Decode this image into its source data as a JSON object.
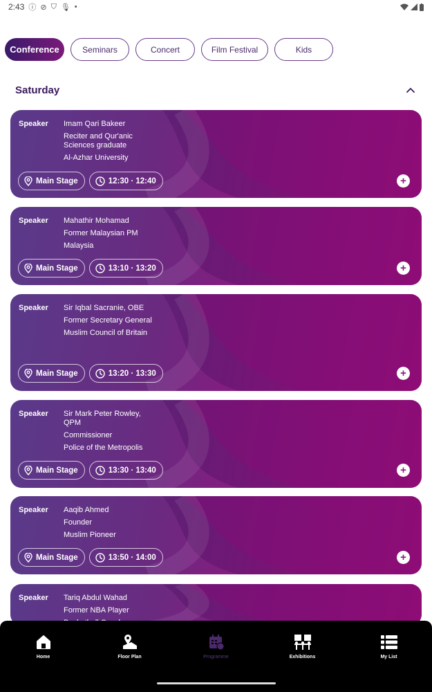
{
  "status_bar": {
    "time": "2:43"
  },
  "filters": [
    {
      "label": "Conference",
      "active": true
    },
    {
      "label": "Seminars",
      "active": false
    },
    {
      "label": "Concert",
      "active": false
    },
    {
      "label": "Film Festival",
      "active": false
    },
    {
      "label": "Kids",
      "active": false
    }
  ],
  "day": {
    "title": "Saturday"
  },
  "cards": [
    {
      "label": "Speaker",
      "lines": [
        "Imam Qari Bakeer",
        "Reciter and Qur'anic Sciences graduate",
        "Al-Azhar University"
      ],
      "location": "Main Stage",
      "time": "12:30 · 12:40"
    },
    {
      "label": "Speaker",
      "lines": [
        "Mahathir Mohamad",
        "Former Malaysian PM",
        "Malaysia"
      ],
      "location": "Main Stage",
      "time": "13:10 · 13:20"
    },
    {
      "label": "Speaker",
      "lines": [
        "Sir Iqbal Sacranie, OBE",
        "Former Secretary General",
        "Muslim Council of Britain"
      ],
      "location": "Main Stage",
      "time": "13:20 · 13:30"
    },
    {
      "label": "Speaker",
      "lines": [
        "Sir Mark Peter Rowley, QPM",
        "Commissioner",
        "Police of the Metropolis"
      ],
      "location": "Main Stage",
      "time": "13:30 · 13:40"
    },
    {
      "label": "Speaker",
      "lines": [
        "Aaqib Ahmed",
        "Founder",
        "Muslim Pioneer"
      ],
      "location": "Main Stage",
      "time": "13:50 · 14:00"
    },
    {
      "label": "Speaker",
      "lines": [
        "Tariq Abdul Wahad",
        "Former NBA Player",
        "Basketball Coach"
      ],
      "location": "",
      "time": ""
    }
  ],
  "nav": [
    {
      "label": "Home",
      "icon": "home-icon"
    },
    {
      "label": "Floor Plan",
      "icon": "map-icon"
    },
    {
      "label": "Programme",
      "icon": "calendar-icon"
    },
    {
      "label": "Exhibitions",
      "icon": "exhibition-icon"
    },
    {
      "label": "My List",
      "icon": "list-icon"
    }
  ],
  "colors": {
    "accent_dark": "#3a1a6a",
    "accent_magenta": "#b01080",
    "nav_bg": "#000000"
  }
}
